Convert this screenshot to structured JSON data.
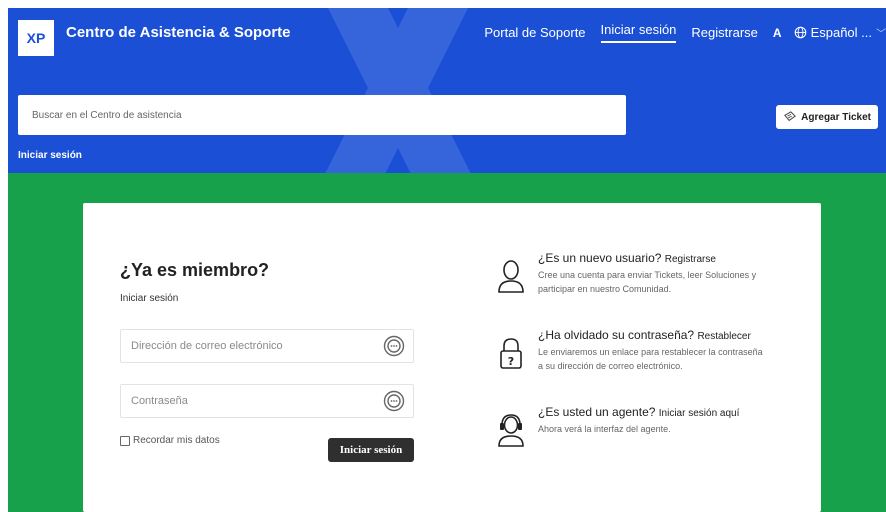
{
  "header": {
    "logo_text": "XP",
    "brand": "Centro de Asistencia & Soporte",
    "nav": {
      "portal": "Portal de Soporte",
      "signin": "Iniciar sesión",
      "register": "Registrarse",
      "font_icon": "A",
      "language": "Español ..."
    },
    "search_placeholder": "Buscar en el Centro de asistencia",
    "signin_link": "Iniciar sesión",
    "add_ticket": "Agregar Ticket"
  },
  "login": {
    "title": "¿Ya es miembro?",
    "subtitle": "Iniciar sesión",
    "email_placeholder": "Dirección de correo electrónico",
    "password_placeholder": "Contraseña",
    "remember": "Recordar mis datos",
    "submit": "Iniciar sesión"
  },
  "info": {
    "new_user": {
      "question": "¿Es un nuevo usuario?",
      "action": "Registrarse",
      "desc_line1": "Cree una cuenta para enviar Tickets, leer Soluciones y",
      "desc_line2": "participar en nuestro Comunidad."
    },
    "forgot": {
      "question": "¿Ha olvidado su contraseña?",
      "action": "Restablecer",
      "desc_line1": "Le enviaremos un enlace para restablecer la contraseña",
      "desc_line2": "a su dirección de correo electrónico."
    },
    "agent": {
      "question": "¿Es usted un agente?",
      "action": "Iniciar sesión aquí",
      "desc_line1": "Ahora verá la interfaz del agente."
    }
  },
  "colors": {
    "header_blue": "#1a4fd6",
    "band_green": "#18a14b",
    "button_dark": "#2f2f2f"
  }
}
